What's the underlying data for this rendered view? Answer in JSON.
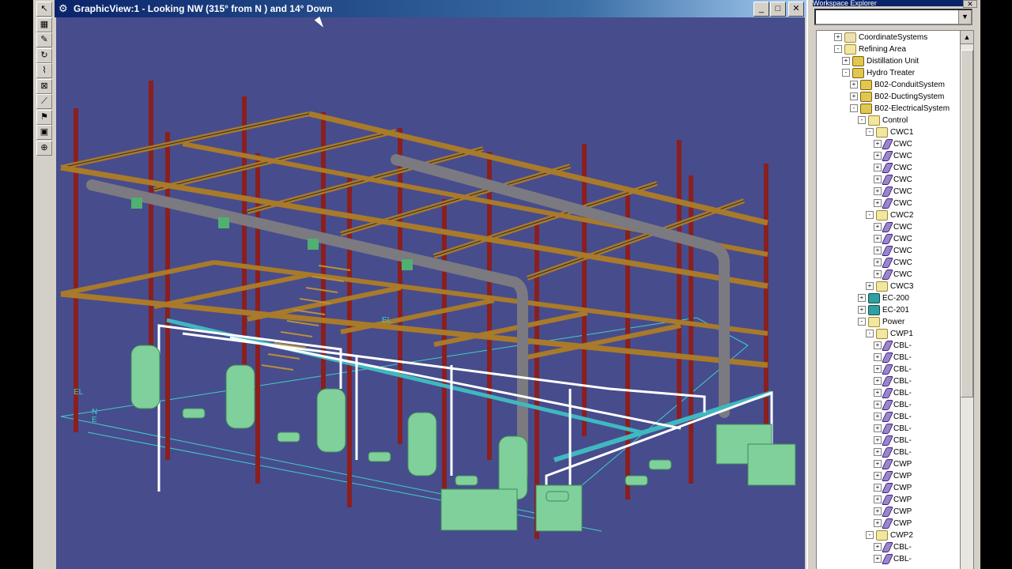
{
  "graphic_view": {
    "title": "GraphicView:1 - Looking NW (315° from N ) and 14° Down",
    "buttons": {
      "minimize": "_",
      "maximize": "□",
      "close": "✕"
    },
    "axis_labels": {
      "el": "EL",
      "n": "N",
      "e": "E",
      "el2": "EL"
    }
  },
  "toolbar": {
    "tools": [
      {
        "icon": "select-arrow-icon",
        "glyph": "↖"
      },
      {
        "icon": "equipment-tool-icon",
        "glyph": "▦"
      },
      {
        "icon": "pencil-tool-icon",
        "glyph": "✎"
      },
      {
        "icon": "rotate-tool-icon",
        "glyph": "↻"
      },
      {
        "icon": "route-tool-icon",
        "glyph": "⌇"
      },
      {
        "icon": "insert-tool-icon",
        "glyph": "⊠"
      },
      {
        "icon": "measure-tool-icon",
        "glyph": "⟋"
      },
      {
        "icon": "place-tool-icon",
        "glyph": "⚑"
      },
      {
        "icon": "view-tool-icon",
        "glyph": "▣"
      },
      {
        "icon": "properties-tool-icon",
        "glyph": "⊕"
      }
    ]
  },
  "explorer": {
    "title": "Workspace Explorer",
    "combo_value": "",
    "tree": [
      {
        "label": "CoordinateSystems",
        "level": 0,
        "icon": "coord",
        "exp": "+"
      },
      {
        "label": "Refining Area",
        "level": 0,
        "icon": "folder",
        "exp": "-"
      },
      {
        "label": "Distillation Unit",
        "level": 1,
        "icon": "sys",
        "exp": "+"
      },
      {
        "label": "Hydro Treater",
        "level": 1,
        "icon": "sys",
        "exp": "-"
      },
      {
        "label": "B02-ConduitSystem",
        "level": 2,
        "icon": "sys",
        "exp": "+"
      },
      {
        "label": "B02-DuctingSystem",
        "level": 2,
        "icon": "sys",
        "exp": "+"
      },
      {
        "label": "B02-ElectricalSystem",
        "level": 2,
        "icon": "sys",
        "exp": "-"
      },
      {
        "label": "Control",
        "level": 3,
        "icon": "folder",
        "exp": "-"
      },
      {
        "label": "CWC1",
        "level": 4,
        "icon": "folder",
        "exp": "-"
      },
      {
        "label": "CWC",
        "level": 5,
        "icon": "cbl",
        "exp": "+"
      },
      {
        "label": "CWC",
        "level": 5,
        "icon": "cbl",
        "exp": "+"
      },
      {
        "label": "CWC",
        "level": 5,
        "icon": "cbl",
        "exp": "+"
      },
      {
        "label": "CWC",
        "level": 5,
        "icon": "cbl",
        "exp": "+"
      },
      {
        "label": "CWC",
        "level": 5,
        "icon": "cbl",
        "exp": "+"
      },
      {
        "label": "CWC",
        "level": 5,
        "icon": "cbl",
        "exp": "+"
      },
      {
        "label": "CWC2",
        "level": 4,
        "icon": "folder",
        "exp": "-"
      },
      {
        "label": "CWC",
        "level": 5,
        "icon": "cbl",
        "exp": "+"
      },
      {
        "label": "CWC",
        "level": 5,
        "icon": "cbl",
        "exp": "+"
      },
      {
        "label": "CWC",
        "level": 5,
        "icon": "cbl",
        "exp": "+"
      },
      {
        "label": "CWC",
        "level": 5,
        "icon": "cbl",
        "exp": "+"
      },
      {
        "label": "CWC",
        "level": 5,
        "icon": "cbl",
        "exp": "+"
      },
      {
        "label": "CWC3",
        "level": 4,
        "icon": "folder",
        "exp": "+"
      },
      {
        "label": "EC-200",
        "level": 3,
        "icon": "eq",
        "exp": "+"
      },
      {
        "label": "EC-201",
        "level": 3,
        "icon": "eq",
        "exp": "+"
      },
      {
        "label": "Power",
        "level": 3,
        "icon": "folder",
        "exp": "-"
      },
      {
        "label": "CWP1",
        "level": 4,
        "icon": "folder",
        "exp": "-"
      },
      {
        "label": "CBL-",
        "level": 5,
        "icon": "cbl",
        "exp": "+"
      },
      {
        "label": "CBL-",
        "level": 5,
        "icon": "cbl",
        "exp": "+"
      },
      {
        "label": "CBL-",
        "level": 5,
        "icon": "cbl",
        "exp": "+"
      },
      {
        "label": "CBL-",
        "level": 5,
        "icon": "cbl",
        "exp": "+"
      },
      {
        "label": "CBL-",
        "level": 5,
        "icon": "cbl",
        "exp": "+"
      },
      {
        "label": "CBL-",
        "level": 5,
        "icon": "cbl",
        "exp": "+"
      },
      {
        "label": "CBL-",
        "level": 5,
        "icon": "cbl",
        "exp": "+"
      },
      {
        "label": "CBL-",
        "level": 5,
        "icon": "cbl",
        "exp": "+"
      },
      {
        "label": "CBL-",
        "level": 5,
        "icon": "cbl",
        "exp": "+"
      },
      {
        "label": "CBL-",
        "level": 5,
        "icon": "cbl",
        "exp": "+"
      },
      {
        "label": "CWP",
        "level": 5,
        "icon": "cbl",
        "exp": "+"
      },
      {
        "label": "CWP",
        "level": 5,
        "icon": "cbl",
        "exp": "+"
      },
      {
        "label": "CWP",
        "level": 5,
        "icon": "cbl",
        "exp": "+"
      },
      {
        "label": "CWP",
        "level": 5,
        "icon": "cbl",
        "exp": "+"
      },
      {
        "label": "CWP",
        "level": 5,
        "icon": "cbl",
        "exp": "+"
      },
      {
        "label": "CWP",
        "level": 5,
        "icon": "cbl",
        "exp": "+"
      },
      {
        "label": "CWP2",
        "level": 4,
        "icon": "folder",
        "exp": "-"
      },
      {
        "label": "CBL-",
        "level": 5,
        "icon": "cbl",
        "exp": "+"
      },
      {
        "label": "CBL-",
        "level": 5,
        "icon": "cbl",
        "exp": "+"
      }
    ]
  },
  "colors": {
    "viewport_bg": "#474c8d",
    "steel_column": "#8a1f1f",
    "steel_beam": "#a87a2a",
    "duct": "#7a7a80",
    "equipment": "#7fd09a",
    "cable": "#ffffff",
    "cable_tray": "#3fb8c0"
  }
}
